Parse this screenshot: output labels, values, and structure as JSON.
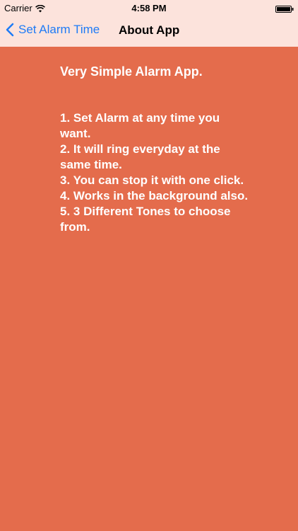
{
  "status_bar": {
    "carrier": "Carrier",
    "time": "4:58 PM",
    "wifi_icon": "wifi-icon",
    "battery_icon": "battery-icon"
  },
  "nav": {
    "back_label": "Set Alarm Time",
    "back_icon": "chevron-left-icon",
    "title": "About App"
  },
  "content": {
    "heading": "Very Simple Alarm App.",
    "features": [
      "1. Set Alarm at any time you want.",
      "2. It will ring everyday at the same time.",
      "3. You can stop it with one click.",
      "4. Works in the background also.",
      "5. 3 Different Tones to choose from."
    ]
  },
  "colors": {
    "background": "#E46C4C",
    "nav_background": "#FCE3DC",
    "accent": "#1E7BF6",
    "text": "#FFFFFF"
  }
}
